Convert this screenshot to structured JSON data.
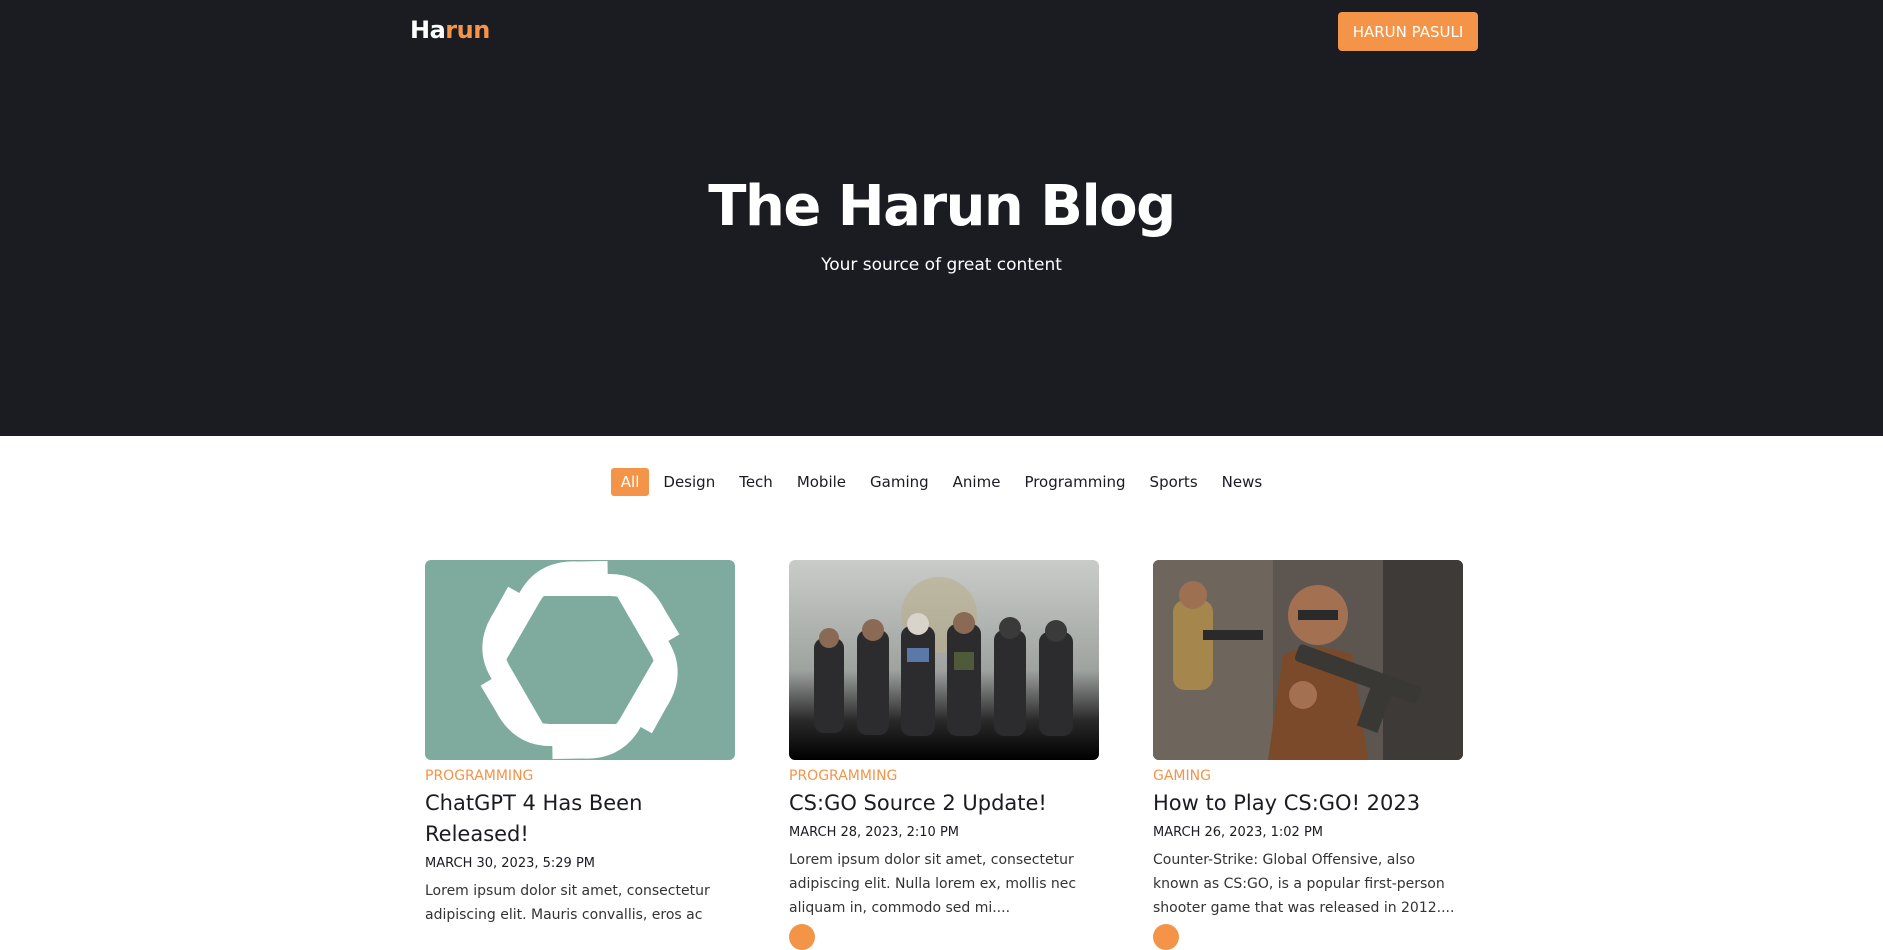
{
  "nav": {
    "logo_part1": "Ha",
    "logo_part2": "run",
    "button_label": "HARUN PASULI"
  },
  "hero": {
    "title": "The Harun Blog",
    "subtitle": "Your source of great content"
  },
  "filters": [
    "All",
    "Design",
    "Tech",
    "Mobile",
    "Gaming",
    "Anime",
    "Programming",
    "Sports",
    "News"
  ],
  "active_filter": "All",
  "posts": [
    {
      "category": "PROGRAMMING",
      "title": "ChatGPT 4 Has Been Released!",
      "date": "MARCH 30, 2023, 5:29 PM",
      "excerpt": "Lorem ipsum dolor sit amet, consectetur adipiscing elit. Mauris convallis, eros ac",
      "image_icon": "openai-logo-icon"
    },
    {
      "category": "PROGRAMMING",
      "title": "CS:GO Source 2 Update!",
      "date": "MARCH 28, 2023, 2:10 PM",
      "excerpt": "Lorem ipsum dolor sit amet, consectetur adipiscing elit. Nulla lorem ex, mollis nec aliquam in, commodo sed mi....",
      "image_icon": "game-characters-image"
    },
    {
      "category": "GAMING",
      "title": "How to Play CS:GO! 2023",
      "date": "MARCH 26, 2023, 1:02 PM",
      "excerpt": "Counter-Strike: Global Offensive, also known as CS:GO, is a popular first-person shooter game that was released in 2012....",
      "image_icon": "soldier-with-rifle-image"
    }
  ],
  "colors": {
    "hero_bg": "#1b1b22",
    "accent": "#f39448",
    "openai_bg": "#7fab9e"
  }
}
